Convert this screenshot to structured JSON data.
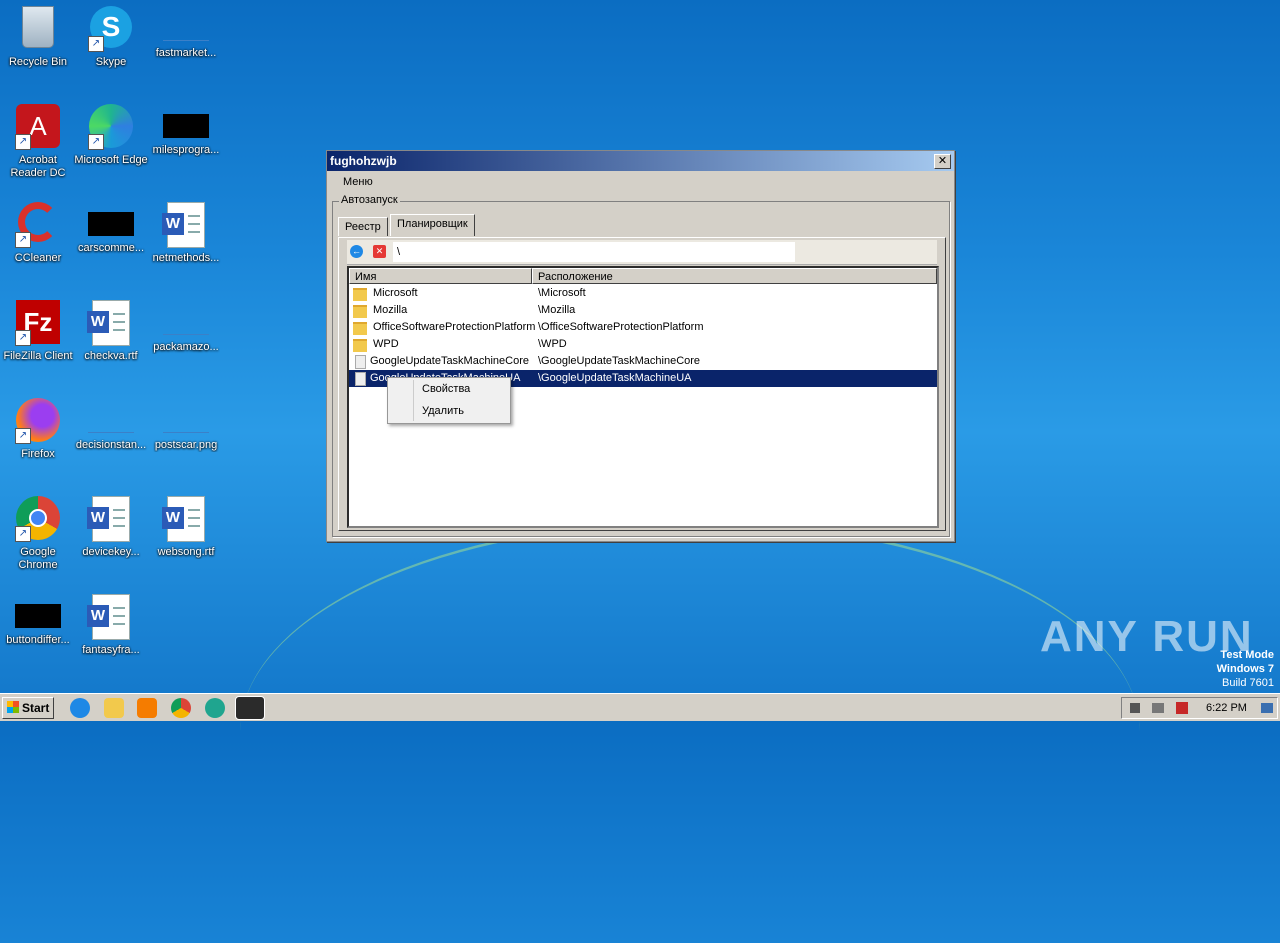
{
  "desktop": {
    "icons": [
      {
        "label": "Recycle Bin"
      },
      {
        "label": "Skype"
      },
      {
        "label": "fastmarket..."
      },
      {
        "label": "Acrobat Reader DC"
      },
      {
        "label": "Microsoft Edge"
      },
      {
        "label": "milesprogra..."
      },
      {
        "label": "CCleaner"
      },
      {
        "label": "carscomme..."
      },
      {
        "label": "netmethods..."
      },
      {
        "label": "FileZilla Client"
      },
      {
        "label": "checkva.rtf"
      },
      {
        "label": "packamazo..."
      },
      {
        "label": "Firefox"
      },
      {
        "label": "decisionstan..."
      },
      {
        "label": "postscar.png"
      },
      {
        "label": "Google Chrome"
      },
      {
        "label": "devicekey..."
      },
      {
        "label": "websong.rtf"
      },
      {
        "label": "buttondiffer..."
      },
      {
        "label": "fantasyfra..."
      }
    ]
  },
  "window": {
    "title": "fughohzwjb",
    "close_glyph": "✕",
    "menu": {
      "label": "Меню"
    },
    "group_title": "Автозапуск",
    "tabs": [
      {
        "label": "Реестр"
      },
      {
        "label": "Планировщик"
      }
    ],
    "path": "\\",
    "columns": {
      "name": "Имя",
      "location": "Расположение"
    },
    "rows": [
      {
        "name": "Microsoft",
        "location": "\\Microsoft",
        "icon": "folder-icon"
      },
      {
        "name": "Mozilla",
        "location": "\\Mozilla",
        "icon": "folder-icon"
      },
      {
        "name": "OfficeSoftwareProtectionPlatform",
        "location": "\\OfficeSoftwareProtectionPlatform",
        "icon": "folder-icon"
      },
      {
        "name": "WPD",
        "location": "\\WPD",
        "icon": "folder-icon"
      },
      {
        "name": "GoogleUpdateTaskMachineCore",
        "location": "\\GoogleUpdateTaskMachineCore",
        "icon": "task-icon"
      },
      {
        "name": "GoogleUpdateTaskMachineUA",
        "location": "\\GoogleUpdateTaskMachineUA",
        "icon": "task-icon"
      }
    ]
  },
  "context_menu": {
    "items": [
      {
        "label": "Свойства"
      },
      {
        "label": "Удалить"
      }
    ]
  },
  "taskbar": {
    "start_label": "Start",
    "clock": "6:22 PM"
  },
  "watermark": {
    "text": "ANY RUN"
  },
  "test_mode": {
    "line1": "Test Mode",
    "line2": "Windows 7",
    "line3": "Build 7601"
  }
}
